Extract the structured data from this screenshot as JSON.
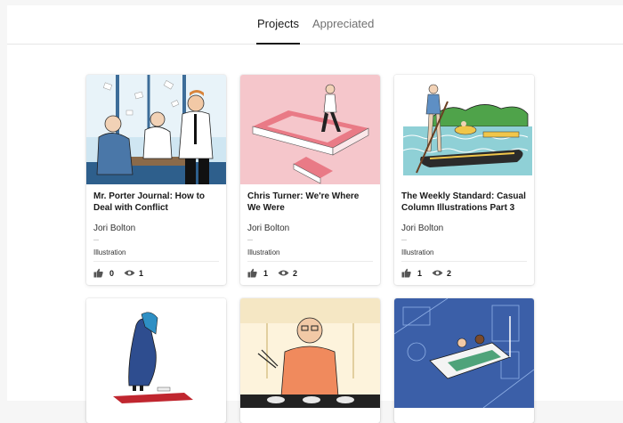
{
  "tabs": [
    {
      "label": "Projects",
      "active": true
    },
    {
      "label": "Appreciated",
      "active": false
    }
  ],
  "projects": [
    {
      "title": "Mr. Porter Journal: How to Deal with Conflict",
      "owner": "Jori Bolton",
      "field": "Illustration",
      "appreciations": "0",
      "views": "1"
    },
    {
      "title": "Chris Turner: We're Where We Were",
      "owner": "Jori Bolton",
      "field": "Illustration",
      "appreciations": "1",
      "views": "2"
    },
    {
      "title": "The Weekly Standard: Casual Column Illustrations Part 3",
      "owner": "Jori Bolton",
      "field": "Illustration",
      "appreciations": "1",
      "views": "2"
    }
  ],
  "colors": {
    "thumb1_bg": "#cfe6f2",
    "thumb2_bg": "#f5c6cb",
    "thumb3_bg": "#ffffff",
    "thumb6_bg": "#3b5fa8"
  }
}
